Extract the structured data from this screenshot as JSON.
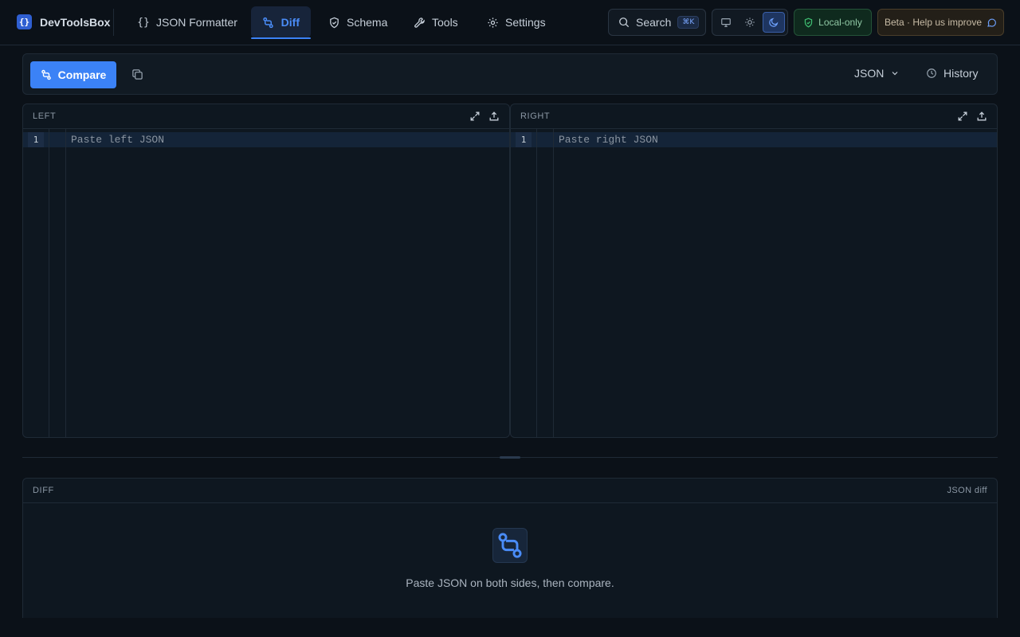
{
  "brand": {
    "logo": "{}",
    "name": "DevToolsBox"
  },
  "nav": [
    {
      "label": "JSON Formatter",
      "icon": "braces-icon",
      "active": false
    },
    {
      "label": "Diff",
      "icon": "git-compare-icon",
      "active": true
    },
    {
      "label": "Schema",
      "icon": "shield-icon",
      "active": false
    },
    {
      "label": "Tools",
      "icon": "wrench-icon",
      "active": false
    },
    {
      "label": "Settings",
      "icon": "gear-icon",
      "active": false
    }
  ],
  "search": {
    "label": "Search",
    "shortcut": "⌘K"
  },
  "theme": {
    "options": [
      "system",
      "light",
      "dark"
    ],
    "selected": "dark"
  },
  "badges": {
    "local": "Local-only",
    "beta": "Beta · Help us improve"
  },
  "toolbar": {
    "compare_label": "Compare",
    "format": "JSON",
    "history_label": "History"
  },
  "left": {
    "title": "LEFT",
    "line_number": "1",
    "placeholder": "Paste left JSON"
  },
  "right": {
    "title": "RIGHT",
    "line_number": "1",
    "placeholder": "Paste right JSON"
  },
  "diff": {
    "title": "DIFF",
    "mode": "JSON diff",
    "empty_message": "Paste JSON on both sides, then compare."
  },
  "colors": {
    "accent": "#3b82f6",
    "background": "#0b1118",
    "panel": "#0e1720",
    "local_badge": "#0f2a1e",
    "beta_badge": "#231f18"
  }
}
